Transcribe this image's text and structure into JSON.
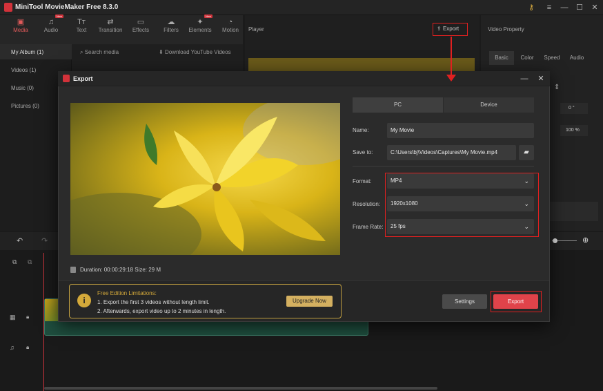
{
  "window": {
    "title": "MiniTool MovieMaker Free 8.3.0",
    "controls": [
      "key-icon",
      "menu-icon",
      "minimize-icon",
      "maximize-icon",
      "close-icon"
    ]
  },
  "toolbar": {
    "items": [
      {
        "label": "Media",
        "icon": "folder-icon",
        "active": true
      },
      {
        "label": "Audio",
        "icon": "music-icon",
        "badge": "New"
      },
      {
        "label": "Text",
        "icon": "text-icon"
      },
      {
        "label": "Transition",
        "icon": "transition-icon"
      },
      {
        "label": "Effects",
        "icon": "effects-icon"
      },
      {
        "label": "Filters",
        "icon": "filters-icon"
      },
      {
        "label": "Elements",
        "icon": "elements-icon",
        "badge": "New"
      },
      {
        "label": "Motion",
        "icon": "motion-icon"
      }
    ]
  },
  "media": {
    "albums": [
      "My Album (1)",
      "Videos (1)",
      "Music (0)",
      "Pictures (0)"
    ],
    "search_placeholder": "Search media",
    "download_label": "Download YouTube Videos"
  },
  "player": {
    "title": "Player",
    "export_label": "Export"
  },
  "property": {
    "title": "Video Property",
    "tabs": [
      "Basic",
      "Color",
      "Speed",
      "Audio"
    ],
    "rotate_value": "0 °",
    "scale_value": "100 %"
  },
  "dialog": {
    "title": "Export",
    "segments": [
      "PC",
      "Device"
    ],
    "name_label": "Name:",
    "name_value": "My Movie",
    "saveto_label": "Save to:",
    "saveto_value": "C:\\Users\\bj\\Videos\\Captures\\My Movie.mp4",
    "format_label": "Format:",
    "format_value": "MP4",
    "resolution_label": "Resolution:",
    "resolution_value": "1920x1080",
    "framerate_label": "Frame Rate:",
    "framerate_value": "25 fps",
    "duration_label": "Duration:",
    "duration_value": "00:00:29:18",
    "size_label": "Size:",
    "size_value": "29 M",
    "limit_title": "Free Edition Limitations:",
    "limit_lines": [
      "1. Export the first 3 videos without length limit.",
      "2. Afterwards, export video up to 2 minutes in length."
    ],
    "upgrade_label": "Upgrade Now",
    "settings_label": "Settings",
    "export_label": "Export"
  },
  "colors": {
    "accent": "#e0434a",
    "highlight": "#e02020",
    "warning": "#d4a93a"
  }
}
